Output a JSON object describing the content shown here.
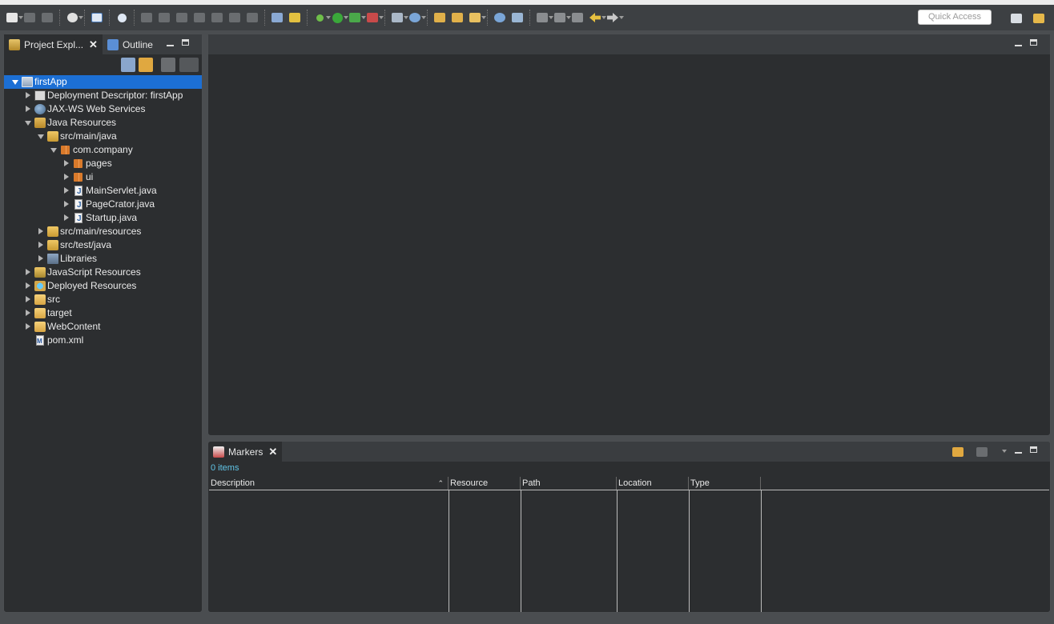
{
  "toolbar": {
    "quick_access_placeholder": "Quick Access"
  },
  "left_panel": {
    "tabs": [
      {
        "label": "Project Expl..."
      },
      {
        "label": "Outline"
      }
    ],
    "tree": [
      {
        "label": "firstApp",
        "icon": "project-icon",
        "selected": true
      },
      {
        "label": "Deployment Descriptor: firstApp",
        "icon": "deployment-descriptor-icon"
      },
      {
        "label": "JAX-WS Web Services",
        "icon": "web-services-icon"
      },
      {
        "label": "Java Resources",
        "icon": "java-resources-icon"
      },
      {
        "label": "src/main/java",
        "icon": "source-folder-icon"
      },
      {
        "label": "com.company",
        "icon": "package-icon"
      },
      {
        "label": "pages",
        "icon": "package-icon"
      },
      {
        "label": "ui",
        "icon": "package-icon"
      },
      {
        "label": "MainServlet.java",
        "icon": "java-file-icon"
      },
      {
        "label": "PageCrator.java",
        "icon": "java-file-icon"
      },
      {
        "label": "Startup.java",
        "icon": "java-file-icon"
      },
      {
        "label": "src/main/resources",
        "icon": "source-folder-icon"
      },
      {
        "label": "src/test/java",
        "icon": "source-folder-icon"
      },
      {
        "label": "Libraries",
        "icon": "libraries-icon"
      },
      {
        "label": "JavaScript Resources",
        "icon": "javascript-resources-icon"
      },
      {
        "label": "Deployed Resources",
        "icon": "deployed-resources-icon"
      },
      {
        "label": "src",
        "icon": "folder-icon"
      },
      {
        "label": "target",
        "icon": "folder-icon"
      },
      {
        "label": "WebContent",
        "icon": "folder-icon"
      },
      {
        "label": "pom.xml",
        "icon": "maven-pom-icon"
      }
    ]
  },
  "markers": {
    "tab_label": "Markers",
    "count_text": "0 items",
    "columns": [
      "Description",
      "Resource",
      "Path",
      "Location",
      "Type"
    ]
  },
  "colors": {
    "selection": "#1c6fd4",
    "count_text": "#60c4e6",
    "panel_bg": "#2c2e30",
    "chrome_bg": "#4a4d50"
  }
}
